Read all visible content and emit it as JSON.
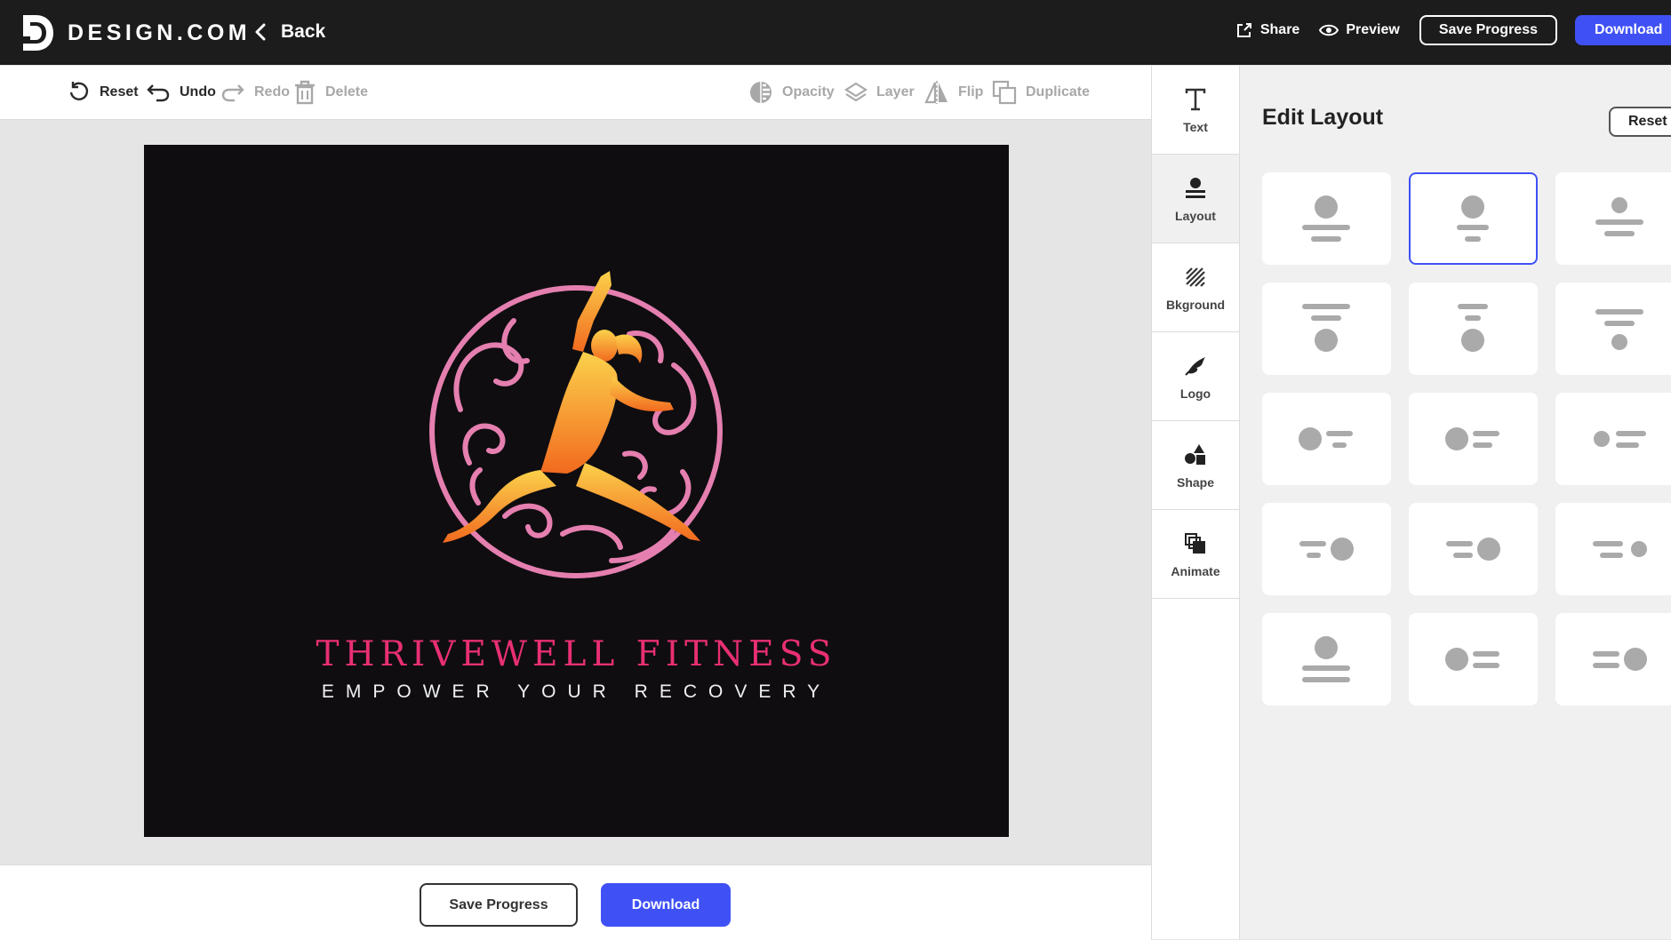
{
  "header": {
    "brand_name": "DESIGN.COM",
    "back_label": "Back",
    "share_label": "Share",
    "preview_label": "Preview",
    "save_label": "Save Progress",
    "download_label": "Download"
  },
  "toolbar": {
    "reset_label": "Reset",
    "undo_label": "Undo",
    "redo_label": "Redo",
    "delete_label": "Delete",
    "opacity_label": "Opacity",
    "layer_label": "Layer",
    "flip_label": "Flip",
    "duplicate_label": "Duplicate"
  },
  "logo": {
    "title": "THRIVEWELL FITNESS",
    "tagline": "EMPOWER YOUR RECOVERY",
    "colors": {
      "background": "#0f0d10",
      "title": "#e92f73",
      "ring": "#e57fb0",
      "figure_top": "#f9c74f",
      "figure_bottom": "#f57c1f"
    }
  },
  "footer": {
    "save_label": "Save Progress",
    "download_label": "Download"
  },
  "rail": {
    "items": [
      {
        "label": "Text",
        "icon": "text-icon"
      },
      {
        "label": "Layout",
        "icon": "layout-icon"
      },
      {
        "label": "Bkground",
        "icon": "background-icon"
      },
      {
        "label": "Logo",
        "icon": "logo-icon"
      },
      {
        "label": "Shape",
        "icon": "shape-icon"
      },
      {
        "label": "Animate",
        "icon": "animate-icon"
      }
    ]
  },
  "panel": {
    "title": "Edit Layout",
    "reset_label": "Reset"
  },
  "colors": {
    "accent": "#3f51f5",
    "topbar": "#1c1c1c",
    "placeholder": "#aaaaaa"
  }
}
